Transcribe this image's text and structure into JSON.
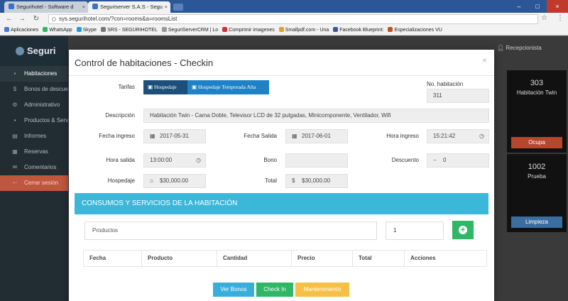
{
  "browser": {
    "tabs": [
      {
        "label": "Segurihotel - Software d"
      },
      {
        "label": "Seguriserver S.A.S - Segu"
      }
    ],
    "url": "sys.segurihotel.com/?con=rooms&a=roomsList",
    "bookmarks": [
      {
        "label": "Aplicaciones",
        "color": "#4a7bd0"
      },
      {
        "label": "WhatsApp",
        "color": "#2fb765"
      },
      {
        "label": "Skype",
        "color": "#1e9be0"
      },
      {
        "label": "SRS - SEGURIHOTEL",
        "color": "#777777"
      },
      {
        "label": "SeguriServerCRM | Lo",
        "color": "#999999"
      },
      {
        "label": "Comprimir imagenes",
        "color": "#cc3333"
      },
      {
        "label": "Smallpdf.com - Una",
        "color": "#e5a124"
      },
      {
        "label": "Facebook Blueprint:",
        "color": "#3b5998"
      },
      {
        "label": "Especializaciones VU",
        "color": "#bb5522"
      }
    ]
  },
  "app": {
    "logo": "Seguri",
    "user_label": "Recepcionista",
    "sidebar": [
      {
        "label": "Habitaciones",
        "icon": "bed-icon",
        "glyph": "▪",
        "active": true
      },
      {
        "label": "Bonos de descuento",
        "icon": "dollar-icon",
        "glyph": "$"
      },
      {
        "label": "Administrativo",
        "icon": "cog-icon",
        "glyph": "⚙"
      },
      {
        "label": "Productos & Servicios",
        "icon": "cart-icon",
        "glyph": "▪"
      },
      {
        "label": "Informes",
        "icon": "chart-icon",
        "glyph": "▤"
      },
      {
        "label": "Reservas",
        "icon": "calendar-icon",
        "glyph": "▦"
      },
      {
        "label": "Comentarios",
        "icon": "comment-icon",
        "glyph": "✉"
      },
      {
        "label": "Cerrar sesión",
        "icon": "logout-icon",
        "glyph": "↩",
        "logout": true
      }
    ],
    "cards": [
      {
        "number": "303",
        "type": "Habitación Twin",
        "status": "Ocupa"
      },
      {
        "number": "1002",
        "type": "Prueba",
        "status": "Limpieza"
      }
    ]
  },
  "modal": {
    "title": "Control de habitaciones - Checkin",
    "close": "×",
    "tarifas_label": "Tarifas",
    "tarifa_hospedaje": "Hospedaje",
    "tarifa_temporada": "Hospedaje Temporada Alta",
    "no_habitacion_label": "No. habitación",
    "no_habitacion_value": "311",
    "descripcion_label": "Descripción",
    "descripcion_value": "Habitación Twin - Cama Doble, Televisor LCD de 32 pulgadas, Minicomponente, Ventilador, Wifi",
    "fecha_ingreso_label": "Fecha ingreso",
    "fecha_ingreso_value": "2017-05-31",
    "fecha_salida_label": "Fecha Salida",
    "fecha_salida_value": "2017-06-01",
    "hora_ingreso_label": "Hora ingreso",
    "hora_ingreso_value": "15:21:42",
    "hora_salida_label": "Hora salida",
    "hora_salida_value": "13:00:00",
    "bono_label": "Bono",
    "bono_value": "",
    "descuento_label": "Descuento",
    "descuento_value": "0",
    "descuento_sign": "−",
    "hospedaje_label": "Hospedaje",
    "hospedaje_value": "$30,000.00",
    "total_label": "Total",
    "total_value": "$30,000.00",
    "currency_symbol": "$",
    "section_title": "CONSUMOS Y SERVICIOS DE LA HABITACIÓN",
    "productos_placeholder": "Productos",
    "cantidad_value": "1",
    "add_glyph": "+",
    "table_headers": [
      "Fecha",
      "Producto",
      "Cantidad",
      "Precio",
      "Total",
      "Acciones"
    ],
    "btn_bonos": "Ver Bonos",
    "btn_checkin": "Check In",
    "btn_mantenimiento": "Mantenimiento"
  }
}
